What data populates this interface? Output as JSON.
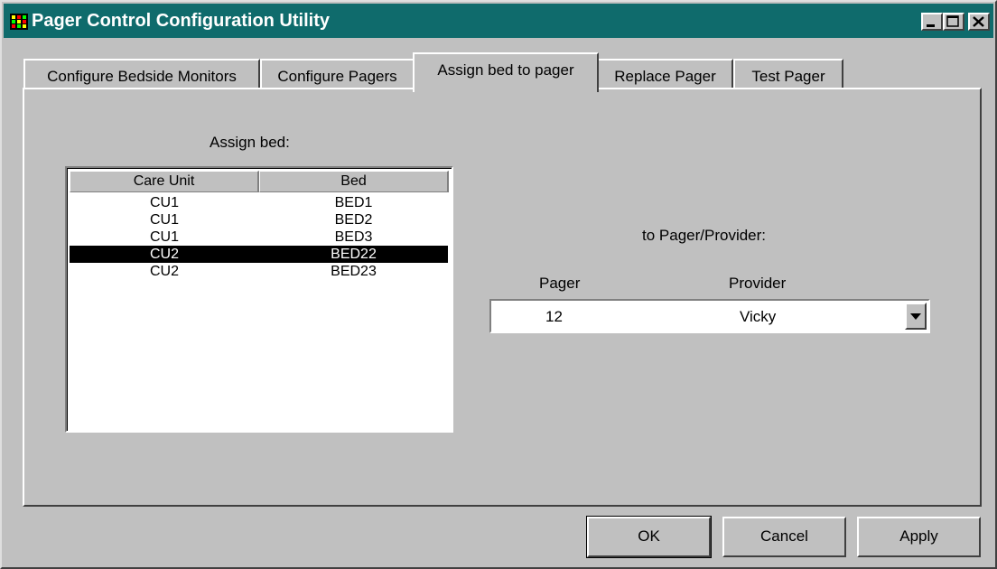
{
  "window": {
    "title": "Pager Control Configuration Utility",
    "icons": {
      "app": "app-grid-icon",
      "minimize": "minimize-icon",
      "maximize": "maximize-icon",
      "close": "close-icon"
    }
  },
  "tabs": [
    {
      "label": "Configure Bedside Monitors",
      "active": false
    },
    {
      "label": "Configure Pagers",
      "active": false
    },
    {
      "label": "Assign bed to pager",
      "active": true
    },
    {
      "label": "Replace Pager",
      "active": false
    },
    {
      "label": "Test Pager",
      "active": false
    }
  ],
  "assign": {
    "heading": "Assign bed:",
    "columns": [
      "Care Unit",
      "Bed"
    ],
    "rows": [
      {
        "care_unit": "CU1",
        "bed": "BED1",
        "selected": false
      },
      {
        "care_unit": "CU1",
        "bed": "BED2",
        "selected": false
      },
      {
        "care_unit": "CU1",
        "bed": "BED3",
        "selected": false
      },
      {
        "care_unit": "CU2",
        "bed": "BED22",
        "selected": true
      },
      {
        "care_unit": "CU2",
        "bed": "BED23",
        "selected": false
      }
    ]
  },
  "pager": {
    "heading": "to Pager/Provider:",
    "col_pager": "Pager",
    "col_provider": "Provider",
    "selected_pager": "12",
    "selected_provider": "Vicky"
  },
  "buttons": {
    "ok": "OK",
    "cancel": "Cancel",
    "apply": "Apply"
  }
}
